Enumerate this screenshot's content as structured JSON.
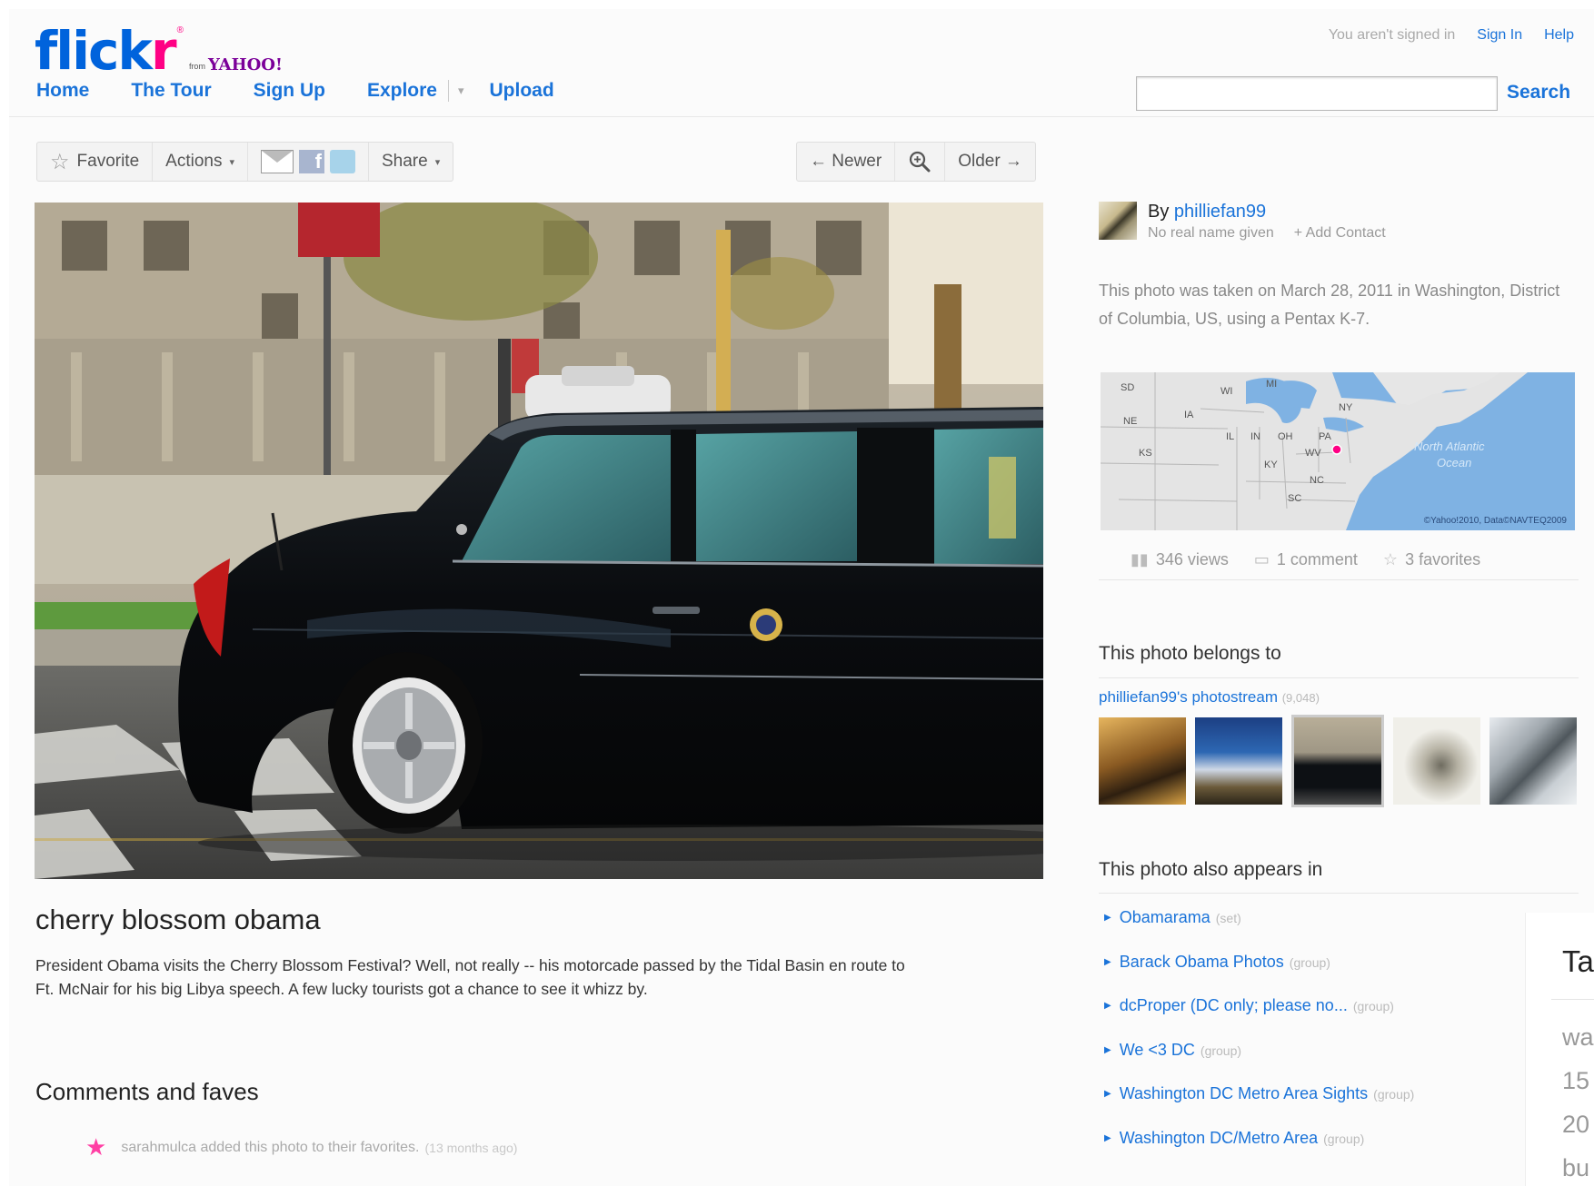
{
  "brand": {
    "wordmark_main": "flick",
    "wordmark_accent": "r",
    "registered": "®",
    "from": "from",
    "yahoo": "YAHOO!"
  },
  "nav": {
    "home": "Home",
    "tour": "The Tour",
    "signup": "Sign Up",
    "explore": "Explore",
    "upload": "Upload",
    "explore_caret": "▾"
  },
  "account": {
    "status": "You aren't signed in",
    "signin": "Sign In",
    "help": "Help"
  },
  "search": {
    "value": "",
    "button": "Search"
  },
  "toolbar": {
    "favorite": "Favorite",
    "actions": "Actions",
    "share": "Share",
    "caret": "▾",
    "fb_letter": "f"
  },
  "pager": {
    "newer": "← Newer",
    "older": "Older →"
  },
  "photo": {
    "title": "cherry blossom obama",
    "description": "President Obama visits the Cherry Blossom Festival? Well, not really -- his motorcade passed by the Tidal Basin en route to Ft. McNair for his big Libya speech. A few lucky tourists got a chance to see it whizz by."
  },
  "comments": {
    "heading": "Comments and faves",
    "fave_text": "sarahmulca added this photo to their favorites.",
    "fave_ago": "(13 months ago)"
  },
  "owner": {
    "by": "By",
    "name": "philliefan99",
    "real_name": "No real name given",
    "add_contact": "+ Add Contact"
  },
  "taken": "This photo was taken on March 28, 2011 in Washington, District of Columbia, US, using a Pentax K-7.",
  "map": {
    "states": [
      "SD",
      "WI",
      "MI",
      "NE",
      "IA",
      "NY",
      "IL",
      "IN",
      "OH",
      "PA",
      "KS",
      "WV",
      "KY",
      "NC",
      "SC"
    ],
    "ocean": [
      "North Atlantic",
      "Ocean"
    ],
    "credit": "©Yahoo!2010, Data©NAVTEQ2009"
  },
  "stats": {
    "views": "346 views",
    "comments": "1 comment",
    "favorites": "3 favorites"
  },
  "belongs": {
    "heading": "This photo belongs to",
    "stream": "philliefan99's photostream",
    "count": "(9,048)"
  },
  "appears": {
    "heading": "This photo also appears in",
    "items": [
      {
        "name": "Obamarama",
        "kind": "(set)"
      },
      {
        "name": "Barack Obama Photos",
        "kind": "(group)"
      },
      {
        "name": "dcProper (DC only; please no...",
        "kind": "(group)"
      },
      {
        "name": "We <3 DC",
        "kind": "(group)"
      },
      {
        "name": "Washington DC Metro Area Sights",
        "kind": "(group)"
      },
      {
        "name": "Washington DC/Metro Area",
        "kind": "(group)"
      }
    ]
  },
  "tags_panel": {
    "heading": "Ta",
    "lines": [
      "wa",
      "15",
      "20",
      "bu"
    ]
  },
  "colors": {
    "brand_blue": "#0063dc",
    "brand_pink": "#ff0084",
    "link": "#1a73d9",
    "map_water": "#7fb2e3"
  }
}
